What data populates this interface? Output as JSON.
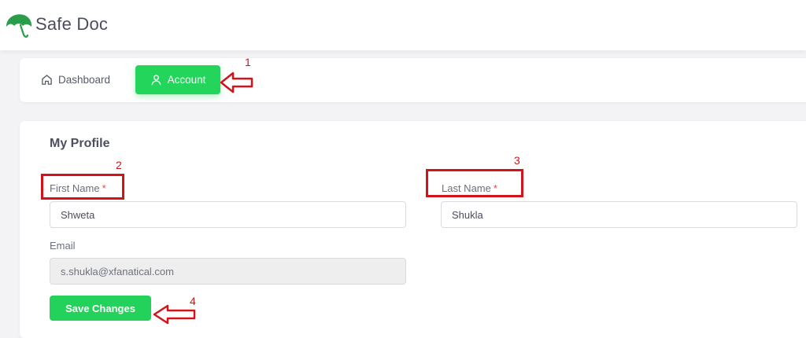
{
  "app": {
    "title": "Safe Doc"
  },
  "nav": {
    "items": [
      {
        "label": "Dashboard",
        "icon": "home-icon",
        "active": false
      },
      {
        "label": "Account",
        "icon": "user-icon",
        "active": true
      }
    ]
  },
  "profile": {
    "title": "My Profile",
    "first_name": {
      "label": "First Name",
      "required_mark": "*",
      "value": "Shweta"
    },
    "last_name": {
      "label": "Last Name",
      "required_mark": "*",
      "value": "Shukla"
    },
    "email": {
      "label": "Email",
      "value": "s.shukla@xfanatical.com"
    },
    "save_label": "Save Changes"
  },
  "annotations": {
    "one": "1",
    "two": "2",
    "three": "3",
    "four": "4"
  },
  "colors": {
    "brand_green": "#24d55b",
    "annotation_red": "#d3131a",
    "required_red": "#e5484d"
  }
}
